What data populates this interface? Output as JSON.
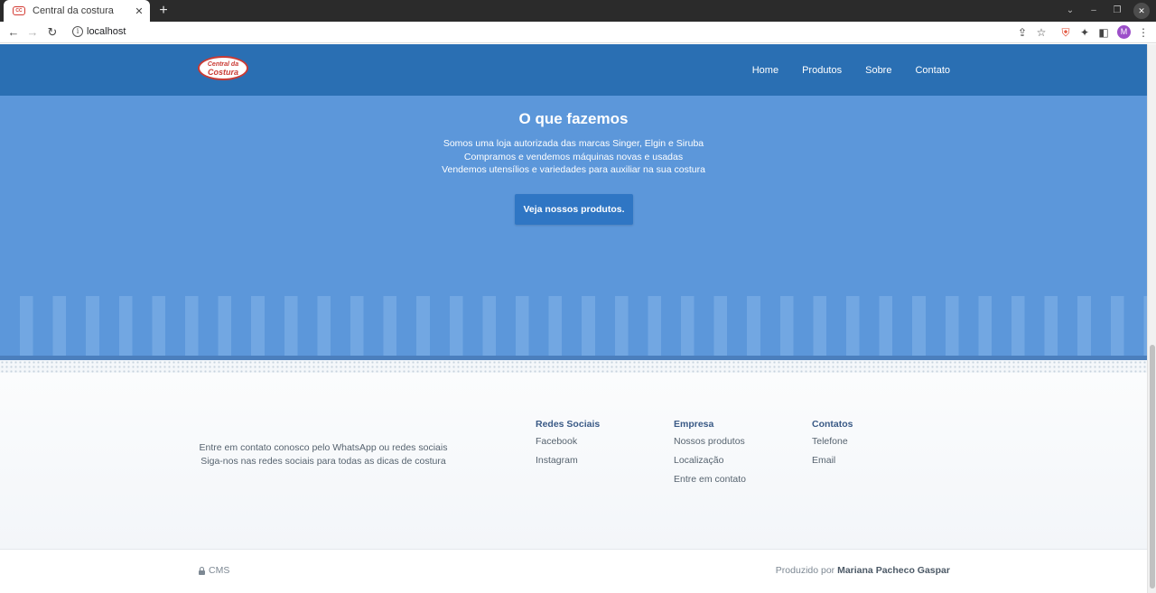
{
  "browser": {
    "tab_title": "Central da costura",
    "tab_favicon": "central-da-costura-favicon",
    "url": "localhost",
    "profile_initial": "M"
  },
  "site": {
    "logo": {
      "line1": "Central da",
      "line2": "Costura"
    },
    "nav": [
      "Home",
      "Produtos",
      "Sobre",
      "Contato"
    ]
  },
  "hero": {
    "title": "O que fazemos",
    "lines": [
      "Somos uma loja autorizada das marcas Singer, Elgin e Siruba",
      "Compramos e vendemos máquinas novas e usadas",
      "Vendemos utensílios e variedades para auxiliar na sua costura"
    ],
    "button": "Veja nossos produtos."
  },
  "footer": {
    "contact_lines": [
      "Entre em contato conosco pelo WhatsApp ou redes sociais",
      "Siga-nos nas redes sociais para todas as dicas de costura"
    ],
    "columns": [
      {
        "title": "Redes Sociais",
        "links": [
          "Facebook",
          "Instagram"
        ]
      },
      {
        "title": "Empresa",
        "links": [
          "Nossos produtos",
          "Localização",
          "Entre em contato"
        ]
      },
      {
        "title": "Contatos",
        "links": [
          "Telefone",
          "Email"
        ]
      }
    ],
    "cms_label": "CMS",
    "credits_prefix": "Produzido por",
    "credits_name": "Mariana Pacheco Gaspar"
  },
  "colors": {
    "header": "#2a6fb3",
    "hero": "#5c97da",
    "button": "#2f76c4",
    "logo_red": "#c93a34"
  }
}
